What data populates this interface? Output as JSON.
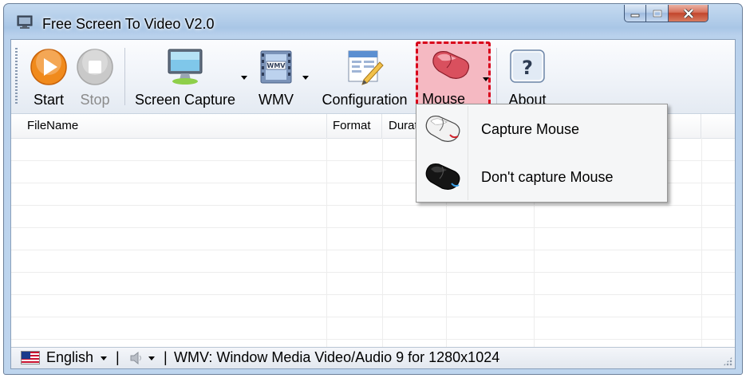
{
  "window": {
    "title": "Free Screen To Video V2.0",
    "controls": {
      "minimize": "minimize",
      "maximize": "maximize",
      "close": "close"
    }
  },
  "toolbar": {
    "buttons": [
      {
        "label": "Start",
        "icon": "play-icon",
        "enabled": true
      },
      {
        "label": "Stop",
        "icon": "stop-icon",
        "enabled": false
      },
      {
        "label": "Screen Capture",
        "icon": "monitor-icon",
        "dropdown": true
      },
      {
        "label": "WMV",
        "icon": "film-wmv-icon",
        "dropdown": true
      },
      {
        "label": "Configuration",
        "icon": "config-pencil-icon"
      },
      {
        "label": "Mouse",
        "icon": "mouse-icon",
        "dropdown": true,
        "highlighted": true
      },
      {
        "label": "About",
        "icon": "question-icon"
      }
    ]
  },
  "grid": {
    "columns": [
      "FileName",
      "Format",
      "Durat",
      "",
      "",
      "",
      ""
    ],
    "rows": []
  },
  "mouse_menu": {
    "items": [
      {
        "label": "Capture Mouse",
        "icon": "white-mouse-icon"
      },
      {
        "label": "Don't capture Mouse",
        "icon": "black-mouse-icon"
      }
    ]
  },
  "statusbar": {
    "language": "English",
    "separator": "|",
    "format_info": "WMV: Window Media Video/Audio 9 for 1280x1024"
  },
  "colors": {
    "highlight_fill": "#f5b9c2",
    "highlight_border": "#d8001a",
    "start_orange": "#f08a1c"
  }
}
